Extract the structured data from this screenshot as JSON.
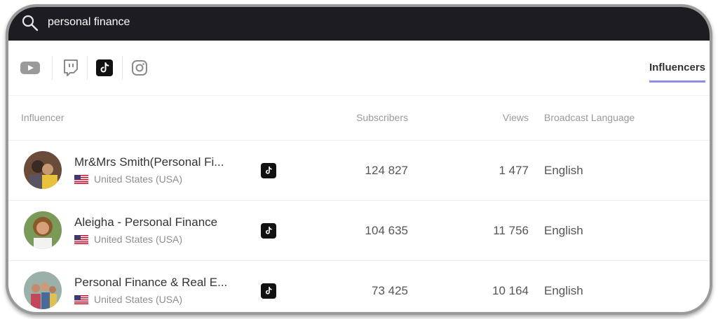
{
  "search": {
    "query": "personal finance"
  },
  "platforms": [
    {
      "name": "youtube-icon",
      "active": false
    },
    {
      "name": "twitch-icon",
      "active": false
    },
    {
      "name": "tiktok-icon",
      "active": true
    },
    {
      "name": "instagram-icon",
      "active": false
    }
  ],
  "tabs": {
    "influencers": "Influencers"
  },
  "table": {
    "headers": {
      "influencer": "Influencer",
      "subscribers": "Subscribers",
      "views": "Views",
      "language": "Broadcast Language"
    },
    "rows": [
      {
        "name": "Mr&Mrs Smith(Personal Fi...",
        "country": "United States (USA)",
        "platform_icon": "tiktok-icon",
        "subscribers": "124 827",
        "views": "1 477",
        "language": "English"
      },
      {
        "name": "Aleigha - Personal Finance",
        "country": "United States (USA)",
        "platform_icon": "tiktok-icon",
        "subscribers": "104 635",
        "views": "11 756",
        "language": "English"
      },
      {
        "name": "Personal Finance & Real E...",
        "country": "United States (USA)",
        "platform_icon": "tiktok-icon",
        "subscribers": "73 425",
        "views": "10 164",
        "language": "English"
      }
    ]
  },
  "colors": {
    "search_bar": "#1c1c22",
    "tab_underline": "#8b8fe8",
    "tiktok": "#111111"
  }
}
